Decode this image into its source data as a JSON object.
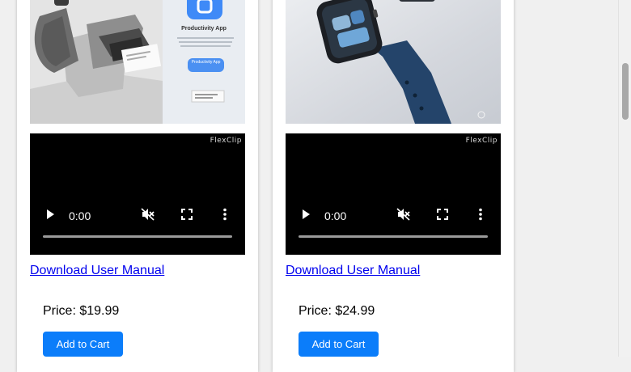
{
  "products": [
    {
      "image_alt": "Speaker product photo",
      "image_lettering": {
        "app_title": "Productivity App",
        "app_button": "Productivity App"
      },
      "video": {
        "time": "0:00",
        "watermark": "FlexClip"
      },
      "manual_link": "Download User Manual",
      "price": "Price: $19.99",
      "add_to_cart": "Add to Cart"
    },
    {
      "image_alt": "Smartwatch product photo",
      "video": {
        "time": "0:00",
        "watermark": "FlexClip"
      },
      "manual_link": "Download User Manual",
      "price": "Price: $24.99",
      "add_to_cart": "Add to Cart"
    }
  ],
  "colors": {
    "button": "#0b7dfa",
    "link": "#0000ee",
    "page_bg": "#f0f0f0"
  }
}
